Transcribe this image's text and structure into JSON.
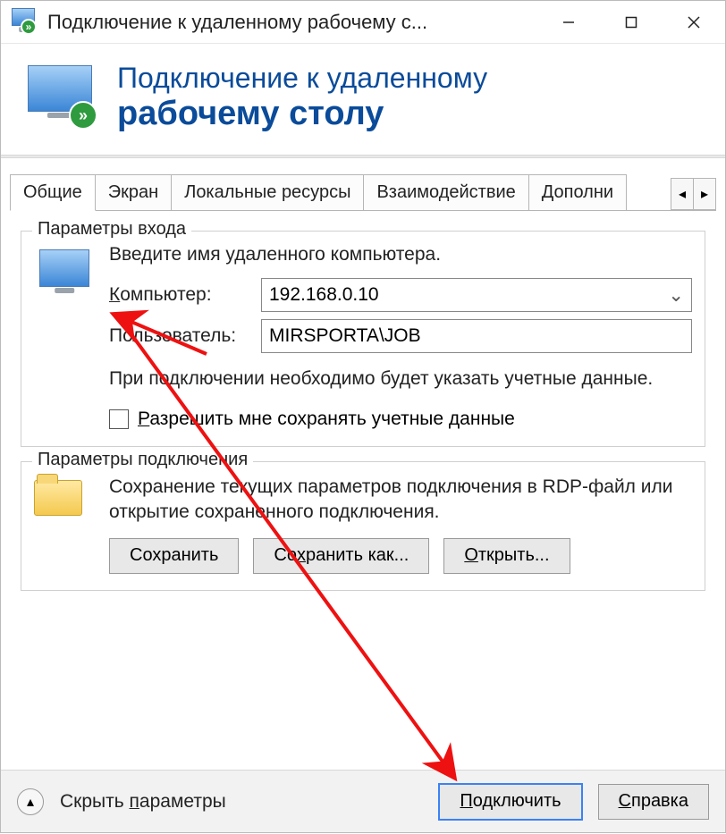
{
  "titlebar": {
    "title": "Подключение к удаленному рабочему с..."
  },
  "banner": {
    "line1": "Подключение к удаленному",
    "line2": "рабочему столу"
  },
  "tabs": {
    "items": [
      "Общие",
      "Экран",
      "Локальные ресурсы",
      "Взаимодействие",
      "Дополни"
    ],
    "active_index": 0
  },
  "login_group": {
    "legend": "Параметры входа",
    "intro": "Введите имя удаленного компьютера.",
    "computer_label": "Компьютер:",
    "computer_value": "192.168.0.10",
    "user_label": "Пользователь:",
    "user_value": "MIRSPORTA\\JOB",
    "note": "При подключении необходимо будет указать учетные данные.",
    "remember_label": "Разрешить мне сохранять учетные данные"
  },
  "conn_group": {
    "legend": "Параметры подключения",
    "desc": "Сохранение текущих параметров подключения в RDP-файл или открытие сохраненного подключения.",
    "save": "Сохранить",
    "save_as": "Сохранить как...",
    "open": "Открыть..."
  },
  "bottom": {
    "toggle_label": "Скрыть параметры",
    "connect": "Подключить",
    "help": "Справка"
  }
}
